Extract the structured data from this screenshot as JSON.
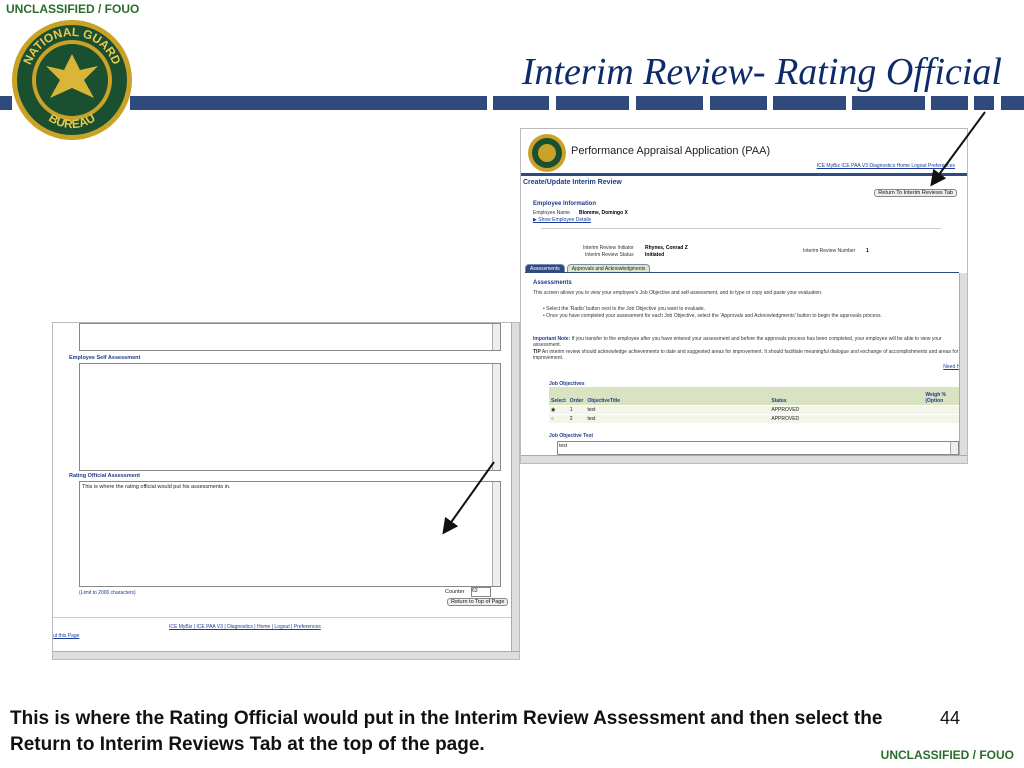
{
  "classification_top": "UNCLASSIFIED / FOUO",
  "classification_bottom": "UNCLASSIFIED / FOUO",
  "slide_title": "Interim Review- Rating Official",
  "seal_text_top": "NATIONAL GUARD",
  "seal_text_bottom": "BUREAU",
  "caption": "This is where the Rating Official would put in the Interim Review Assessment and then select the Return to Interim Reviews Tab at the top of the page.",
  "page_number": "44",
  "colors": {
    "navy": "#2f4b7c",
    "title": "#0d2b6b",
    "classification": "#2a6e2a"
  },
  "app": {
    "title": "Performance Appraisal Application (PAA)",
    "links": "ICE MyBiz  ICE PAA V3  Diagnostics  Home  Logout  Preferences",
    "page_heading": "Create/Update Interim Review",
    "return_button": "Return To Interim Reviews Tab",
    "employee_info_heading": "Employee Information",
    "employee_name_label": "Employee Name",
    "employee_name": "Blomme, Domingo X",
    "show_details": "Show Employee Details",
    "initiator_label": "Interim Review Initiator",
    "initiator": "Rhynes, Conrad Z",
    "status_label": "Interim Review Status",
    "status": "Initiated",
    "number_label": "Interim Review Number",
    "number": "1",
    "tabs": [
      "Assessments",
      "Approvals and Acknowledgments"
    ],
    "assessments_heading": "Assessments",
    "assessments_desc": "This screen allows you to view your employee's Job Objective and self-assessment, and to type or copy and paste your evaluation.",
    "bullets": [
      "Select the 'Radio' button next to the Job Objective you want to evaluate.",
      "Once you have completed your assessment for each Job Objective, select the 'Approvals and Acknowledgments' button to begin the approvals process."
    ],
    "important_label": "Important Note:",
    "important_text": "If you transfer to the employee after you have entered your assessment and before the approvals process has been completed, your employee will be able to view your assessment.",
    "tip_label": "TIP",
    "tip_text": "An interim review should acknowledge achievements to date and suggested areas for improvement. It should facilitate meaningful dialogue and exchange of accomplishments and areas for improvement.",
    "need_help": "Need He",
    "job_objectives_heading": "Job Objectives",
    "columns": [
      "Select",
      "Order",
      "ObjectiveTitle",
      "Status",
      "Weigh % (Option"
    ],
    "rows": [
      {
        "order": "1",
        "title": "test",
        "status": "APPROVED"
      },
      {
        "order": "2",
        "title": "test",
        "status": "APPROVED"
      }
    ],
    "job_objective_text_label": "Job Objective Text",
    "job_objective_text": "test"
  },
  "lower": {
    "self_assessment_label": "Employee Self Assessment",
    "rating_label": "Rating Official Assessment",
    "rating_text": "This is where the rating official would put his assessments in.",
    "limit_text": "(Limit to 2000 characters)",
    "counter_label": "Counter",
    "counter_value": "63",
    "return_top": "Return to Top of Page",
    "footer_links": "ICE MyBiz  |  ICE PAA V3  |  Diagnostics  |  Home  |  Logout  |  Preferences",
    "about_page": "ut this Page"
  }
}
